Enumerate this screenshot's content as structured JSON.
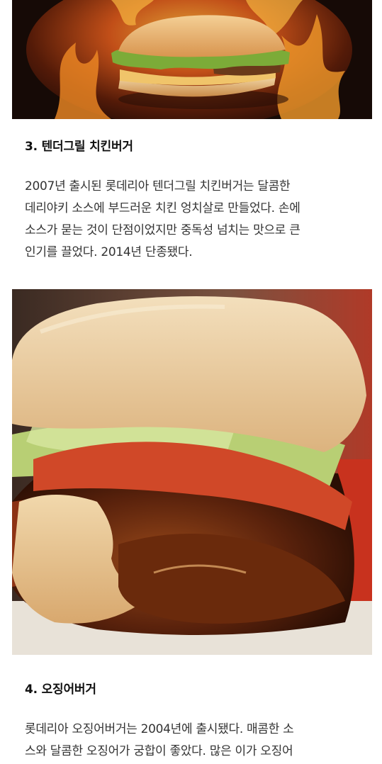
{
  "sections": [
    {
      "heading": "3. 텐더그릴 치킨버거",
      "paragraph_lines": [
        "2007년 출시된 롯데리아 텐더그릴 치킨버거는 달콤한",
        "데리야키 소스에 부드러운 치킨 엉치살로 만들었다. 손에",
        "소스가 묻는 것이 단점이었지만 중독성 넘치는 맛으로 큰",
        "인기를 끌었다. 2014년 단종됐다."
      ]
    },
    {
      "heading": "4. 오징어버거",
      "paragraph_lines": [
        "롯데리아 오징어버거는 2004년에 출시됐다. 매콤한 소",
        "스와 달콤한 오징어가 궁합이 좋았다. 많은 이가 오징어"
      ]
    }
  ],
  "colors": {
    "background": "#ffffff",
    "fire_dark": "#1a0d08",
    "fire_orange": "#f07a1a",
    "bun": "#e9b071",
    "lettuce": "#a3c25a",
    "tomato": "#d04828",
    "teriyaki": "#5a220c"
  }
}
